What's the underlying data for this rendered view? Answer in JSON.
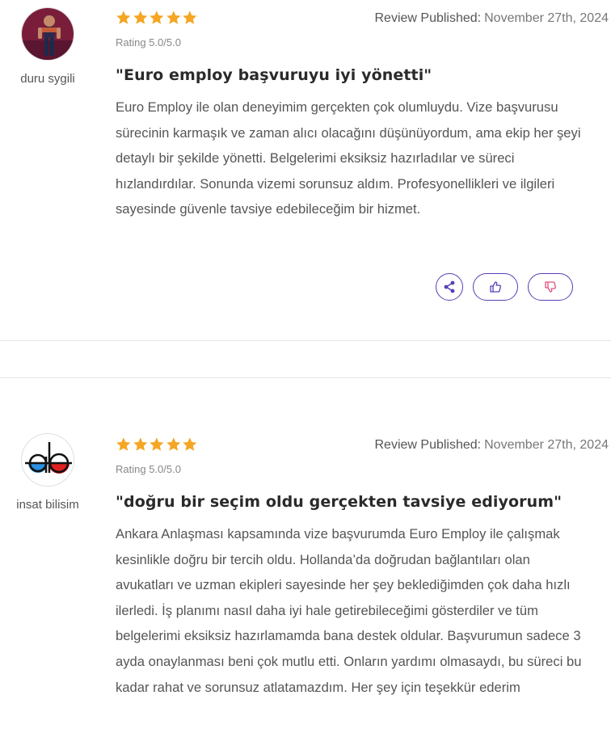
{
  "reviews": [
    {
      "author": "duru sygili",
      "avatar_icon": "user-photo-avatar",
      "stars": 5,
      "rating_text": "Rating 5.0/5.0",
      "published_label": "Review Published:",
      "published_date": "November 27th, 2024",
      "title": "\"Euro employ başvuruyu iyi yönetti\"",
      "body": "Euro Employ ile olan deneyimim gerçekten çok olumluydu. Vize başvurusu sürecinin karmaşık ve zaman alıcı olacağını düşünüyordum, ama ekip her şeyi detaylı bir şekilde yönetti. Belgelerimi eksiksiz hazırladılar ve süreci hızlandırdılar. Sonunda vizemi sorunsuz aldım. Profesyonellikleri ve ilgileri sayesinde güvenle tavsiye edebileceğim bir hizmet.",
      "actions": [
        "share-icon",
        "thumbs-up-icon",
        "thumbs-down-icon"
      ]
    },
    {
      "author": "insat bilisim",
      "avatar_icon": "ab-logo-avatar",
      "stars": 5,
      "rating_text": "Rating 5.0/5.0",
      "published_label": "Review Published:",
      "published_date": "November 27th, 2024",
      "title": "\"doğru bir seçim oldu gerçekten tavsiye ediyorum\"",
      "body": "Ankara Anlaşması kapsamında vize başvurumda Euro Employ ile çalışmak kesinlikle doğru bir tercih oldu. Hollanda’da doğrudan bağlantıları olan avukatları ve uzman ekipleri sayesinde her şey beklediğimden çok daha hızlı ilerledi. İş planımı nasıl daha iyi hale getirebileceğimi gösterdiler ve tüm belgelerimi eksiksiz hazırlamamda bana destek oldular. Başvurumun sadece 3 ayda onaylanması beni çok mutlu etti. Onların yardımı olmasaydı, bu süreci bu kadar rahat ve sorunsuz atlatamazdım. Her şey için teşekkür ederim"
    }
  ],
  "colors": {
    "star": "#f5a623",
    "button_border": "#5a3db7",
    "share_icon": "#5a3db7",
    "like_icon": "#5a3db7",
    "dislike_icon": "#e0507a"
  }
}
